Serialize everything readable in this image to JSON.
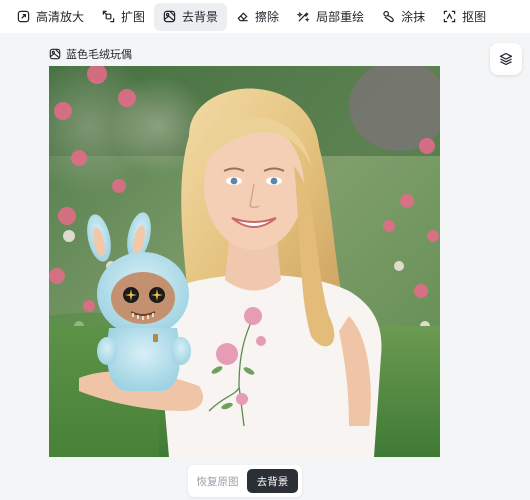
{
  "toolbar": {
    "items": [
      {
        "label": "高清放大",
        "icon": "upscale-icon",
        "active": false
      },
      {
        "label": "扩图",
        "icon": "expand-icon",
        "active": false
      },
      {
        "label": "去背景",
        "icon": "remove-background-icon",
        "active": true
      },
      {
        "label": "擦除",
        "icon": "eraser-icon",
        "active": false
      },
      {
        "label": "局部重绘",
        "icon": "inpaint-icon",
        "active": false
      },
      {
        "label": "涂抹",
        "icon": "smudge-icon",
        "active": false
      },
      {
        "label": "抠图",
        "icon": "cutout-icon",
        "active": false
      }
    ]
  },
  "canvas": {
    "title": "蓝色毛绒玩偶",
    "title_icon": "remove-background-icon",
    "layers_icon": "layers-icon"
  },
  "compare": {
    "original_label": "恢复原图",
    "result_label": "去背景",
    "selected": "result"
  },
  "colors": {
    "active_tab_bg": "#eceef1",
    "toggle_selected_bg": "#2b2f36",
    "toggle_unselected_text": "#9aa0a8"
  }
}
